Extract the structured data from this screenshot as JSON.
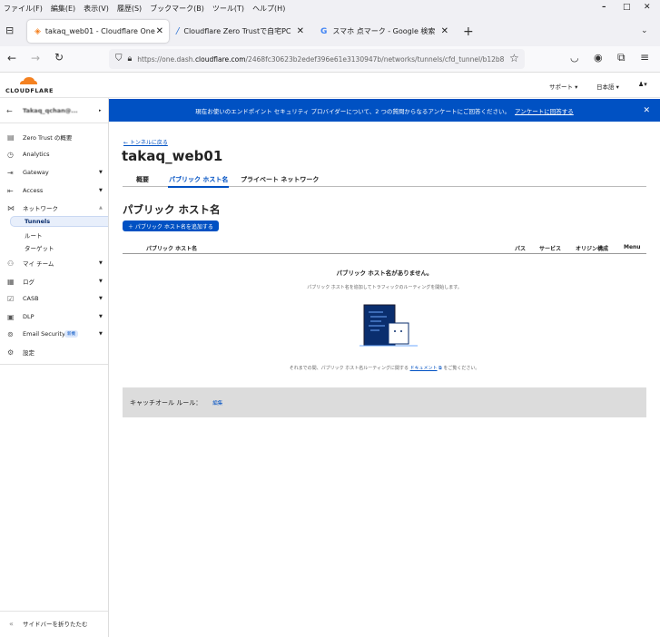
{
  "menubar": {
    "items": [
      "ファイル(F)",
      "編集(E)",
      "表示(V)",
      "履歴(S)",
      "ブックマーク(B)",
      "ツール(T)",
      "ヘルプ(H)"
    ]
  },
  "tabs": [
    {
      "title": "takaq_web01 - Cloudflare One",
      "active": true
    },
    {
      "title": "Cloudflare Zero Trustで自宅PC",
      "active": false
    },
    {
      "title": "スマホ 点マーク - Google 検索",
      "active": false
    }
  ],
  "url": {
    "prefix": "https://one.dash.",
    "domain": "cloudflare.com",
    "path": "/2468fc30623b2edef396e61e3130947b/networks/tunnels/cfd_tunnel/b12b8"
  },
  "cf_header": {
    "logo": "CLOUDFLARE",
    "support": "サポート ▾",
    "language": "日本語 ▾",
    "user_icon": "user-icon"
  },
  "sidebar": {
    "account": "Takaq_qchan@...",
    "items": [
      {
        "label": "Zero Trust の概要",
        "icon": "book-icon"
      },
      {
        "label": "Analytics",
        "icon": "clock-icon"
      },
      {
        "label": "Gateway",
        "icon": "gateway-icon",
        "chevron": "▼"
      },
      {
        "label": "Access",
        "icon": "access-icon",
        "chevron": "▼"
      },
      {
        "label": "ネットワーク",
        "icon": "network-icon",
        "chevron": "▲"
      },
      {
        "label": "マイ チーム",
        "icon": "team-icon",
        "chevron": "▼"
      },
      {
        "label": "ログ",
        "icon": "log-icon",
        "chevron": "▼"
      },
      {
        "label": "CASB",
        "icon": "casb-icon",
        "chevron": "▼"
      },
      {
        "label": "DLP",
        "icon": "dlp-icon",
        "chevron": "▼"
      },
      {
        "label": "Email Security",
        "icon": "email-icon",
        "chevron": "▼",
        "badge": "新機"
      },
      {
        "label": "設定",
        "icon": "gear-icon"
      }
    ],
    "subitems": [
      "Tunnels",
      "ルート",
      "ターゲット"
    ],
    "collapse": "サイドバーを折りたたむ"
  },
  "banner": {
    "text": "現在お使いのエンドポイント セキュリティ プロバイダーについて、2 つの質問からなるアンケートにご回答ください。",
    "link": "アンケートに回答する"
  },
  "main": {
    "back_link": "← トンネルに戻る",
    "tunnel_name": "takaq_web01",
    "tabs": [
      "概要",
      "パブリック ホスト名",
      "プライベート ネットワーク"
    ],
    "section_title": "パブリック ホスト名",
    "add_button": "＋ パブリック ホスト名を追加する",
    "table_headers": [
      "パブリック ホスト名",
      "パス",
      "サービス",
      "オリジン構成",
      "Menu"
    ],
    "empty_title": "パブリック ホスト名がありません。",
    "empty_desc": "パブリック ホスト名を追加してトラフィックのルーティングを開始します。",
    "doc_prefix": "それまでの間、パブリック ホスト名ルーティングに関する",
    "doc_link": "ドキュメント",
    "doc_suffix": "をご覧ください。",
    "catchall_label": "キャッチオール ルール：",
    "catchall_edit": "編集"
  }
}
